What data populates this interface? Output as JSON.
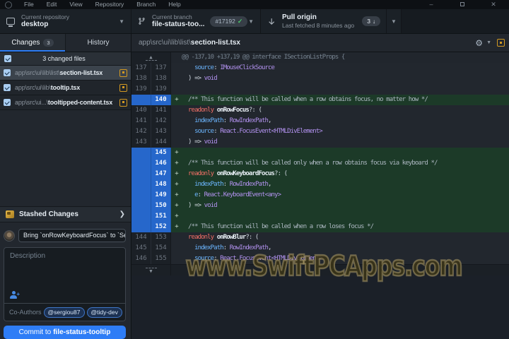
{
  "menu": {
    "items": [
      "File",
      "Edit",
      "View",
      "Repository",
      "Branch",
      "Help"
    ]
  },
  "window_controls": {
    "minimize": "–",
    "close": "✕"
  },
  "toolbar": {
    "repository": {
      "label": "Current repository",
      "value": "desktop"
    },
    "branch": {
      "label": "Current branch",
      "value": "file-status-too...",
      "badge": "#17192"
    },
    "pull": {
      "label": "Pull origin",
      "sublabel": "Last fetched 8 minutes ago",
      "badge_count": "3"
    }
  },
  "tabs": {
    "changes": "Changes",
    "changes_count": "3",
    "history": "History"
  },
  "sidebar": {
    "files_header": "3 changed files",
    "files": [
      {
        "dir": "app\\src\\ui\\lib\\list\\",
        "name": "section-list.tsx"
      },
      {
        "dir": "app\\src\\ui\\lib\\",
        "name": "tooltip.tsx"
      },
      {
        "dir": "app\\src\\ui...\\",
        "name": "tooltipped-content.tsx"
      }
    ],
    "stashed_label": "Stashed Changes",
    "commit": {
      "summary_value": "Bring `onRowKeyboardFocus` to `Se",
      "description_placeholder": "Description",
      "coauthors_label": "Co-Authors",
      "coauthors": [
        "@sergiou87",
        "@tidy-dev"
      ],
      "button_prefix": "Commit to",
      "button_branch": "file-status-tooltip"
    }
  },
  "diff": {
    "file_dir": "app\\src\\ui\\lib\\list\\",
    "file_name": "section-list.tsx",
    "rows": [
      {
        "y": "hunk",
        "text": "@@ -137,10 +137,19 @@ interface ISectionListProps {"
      },
      {
        "y": "ctx",
        "o": "137",
        "n": "137",
        "code": [
          [
            "p",
            "    source"
          ],
          [
            "d",
            ": "
          ],
          [
            "t",
            "IMouseClickSource"
          ]
        ]
      },
      {
        "y": "ctx",
        "o": "138",
        "n": "138",
        "code": [
          [
            "d",
            "  ) => "
          ],
          [
            "t",
            "void"
          ]
        ]
      },
      {
        "y": "ctx",
        "o": "139",
        "n": "139",
        "code": []
      },
      {
        "y": "add",
        "o": "",
        "n": "140",
        "code": [
          [
            "c",
            "  /** This function will be called when a row obtains focus, no matter how */"
          ]
        ]
      },
      {
        "y": "ctx",
        "o": "140",
        "n": "141",
        "code": [
          [
            "k",
            "  readonly "
          ],
          [
            "b",
            "onRowFocus"
          ],
          [
            "d",
            "?: ("
          ]
        ]
      },
      {
        "y": "ctx",
        "o": "141",
        "n": "142",
        "code": [
          [
            "p",
            "    indexPath"
          ],
          [
            "d",
            ": "
          ],
          [
            "t",
            "RowIndexPath"
          ],
          [
            "d",
            ","
          ]
        ]
      },
      {
        "y": "ctx",
        "o": "142",
        "n": "143",
        "code": [
          [
            "p",
            "    source"
          ],
          [
            "d",
            ": "
          ],
          [
            "t",
            "React.FocusEvent<HTMLDivElement>"
          ]
        ]
      },
      {
        "y": "ctx",
        "o": "143",
        "n": "144",
        "code": [
          [
            "d",
            "  ) => "
          ],
          [
            "t",
            "void"
          ]
        ]
      },
      {
        "y": "add",
        "o": "",
        "n": "145",
        "code": []
      },
      {
        "y": "add",
        "o": "",
        "n": "146",
        "code": [
          [
            "c",
            "  /** This function will be called only when a row obtains focus via keyboard */"
          ]
        ]
      },
      {
        "y": "add",
        "o": "",
        "n": "147",
        "code": [
          [
            "k",
            "  readonly "
          ],
          [
            "b",
            "onRowKeyboardFocus"
          ],
          [
            "d",
            "?: ("
          ]
        ]
      },
      {
        "y": "add",
        "o": "",
        "n": "148",
        "code": [
          [
            "p",
            "    indexPath"
          ],
          [
            "d",
            ": "
          ],
          [
            "t",
            "RowIndexPath"
          ],
          [
            "d",
            ","
          ]
        ]
      },
      {
        "y": "add",
        "o": "",
        "n": "149",
        "code": [
          [
            "p",
            "    e"
          ],
          [
            "d",
            ": "
          ],
          [
            "t",
            "React.KeyboardEvent<any>"
          ]
        ]
      },
      {
        "y": "add",
        "o": "",
        "n": "150",
        "code": [
          [
            "d",
            "  ) => "
          ],
          [
            "t",
            "void"
          ]
        ]
      },
      {
        "y": "add",
        "o": "",
        "n": "151",
        "code": []
      },
      {
        "y": "add",
        "o": "",
        "n": "152",
        "code": [
          [
            "c",
            "  /** This function will be called when a row loses focus */"
          ]
        ]
      },
      {
        "y": "ctx",
        "o": "144",
        "n": "153",
        "code": [
          [
            "k",
            "  readonly "
          ],
          [
            "b",
            "onRowBlur"
          ],
          [
            "d",
            "?: ("
          ]
        ]
      },
      {
        "y": "ctx",
        "o": "145",
        "n": "154",
        "code": [
          [
            "p",
            "    indexPath"
          ],
          [
            "d",
            ": "
          ],
          [
            "t",
            "RowIndexPath"
          ],
          [
            "d",
            ","
          ]
        ]
      },
      {
        "y": "ctx",
        "o": "146",
        "n": "155",
        "code": [
          [
            "p",
            "    source"
          ],
          [
            "d",
            ": "
          ],
          [
            "t",
            "React.FocusEvent<HTMLDivElement>"
          ]
        ]
      },
      {
        "y": "expand"
      }
    ]
  },
  "watermark": "www.SwiftPCApps.com"
}
